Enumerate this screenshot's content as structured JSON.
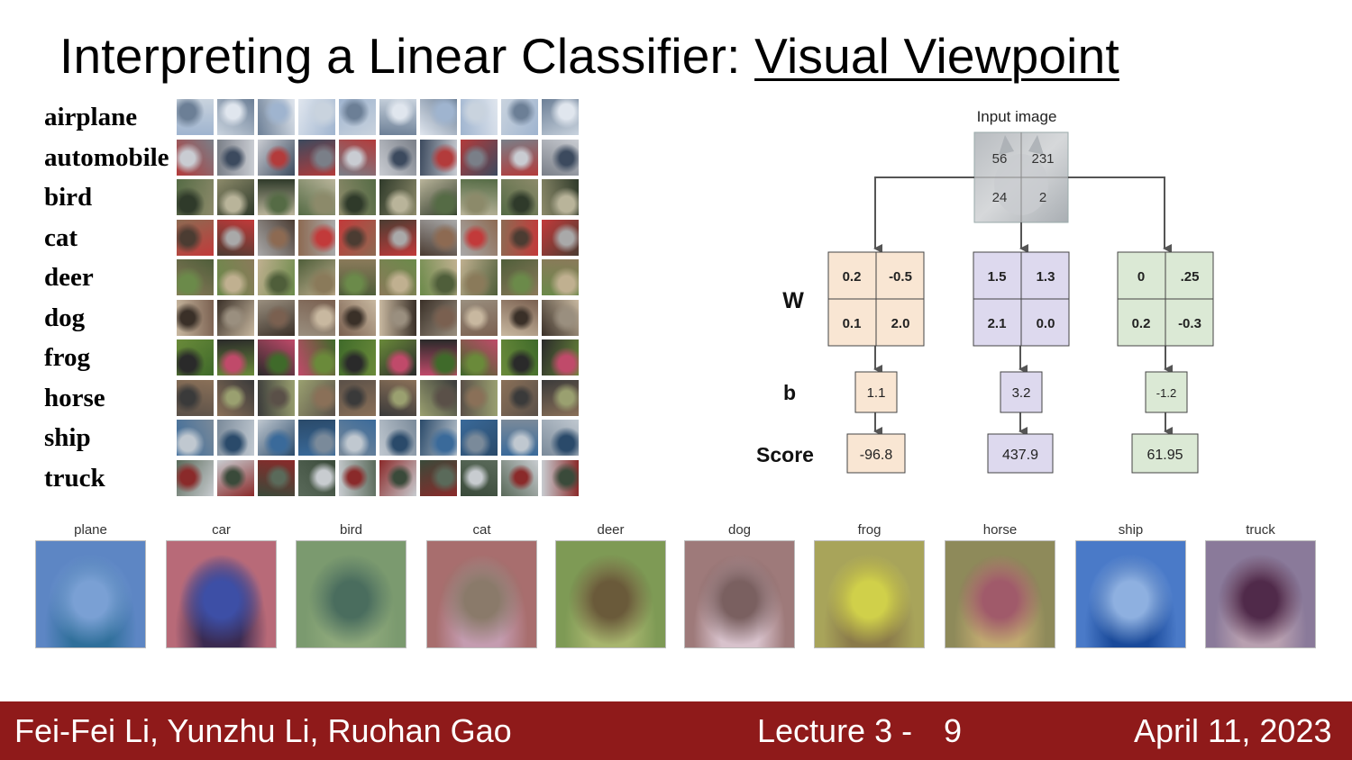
{
  "slide": {
    "title_plain": "Interpreting a Linear Classifier: ",
    "title_underlined": "Visual Viewpoint"
  },
  "classes": [
    "airplane",
    "automobile",
    "bird",
    "cat",
    "deer",
    "dog",
    "frog",
    "horse",
    "ship",
    "truck"
  ],
  "diagram": {
    "input_label": "Input image",
    "pixels": [
      "56",
      "231",
      "24",
      "2"
    ],
    "w_label": "W",
    "b_label": "b",
    "score_label": "Score",
    "columns": [
      {
        "w": [
          "0.2",
          "-0.5",
          "0.1",
          "2.0"
        ],
        "b": "1.1",
        "score": "-96.8",
        "color": "#f9e6d3"
      },
      {
        "w": [
          "1.5",
          "1.3",
          "2.1",
          "0.0"
        ],
        "b": "3.2",
        "score": "437.9",
        "color": "#ddd9ee"
      },
      {
        "w": [
          "0",
          ".25",
          "0.2",
          "-0.3"
        ],
        "b": "-1.2",
        "score": "61.95",
        "color": "#dbe9d5"
      }
    ]
  },
  "templates": [
    {
      "label": "plane",
      "colors": [
        "#5d86c4",
        "#7aa0d4",
        "#2f6f9a"
      ]
    },
    {
      "label": "car",
      "colors": [
        "#b86a78",
        "#3d4fa6",
        "#3a2a50"
      ]
    },
    {
      "label": "bird",
      "colors": [
        "#7b9a6f",
        "#4a6d5e",
        "#8ea97b"
      ]
    },
    {
      "label": "cat",
      "colors": [
        "#a86e6e",
        "#8a7a6a",
        "#c49cb0"
      ]
    },
    {
      "label": "deer",
      "colors": [
        "#7e9a55",
        "#6a5a3a",
        "#a7b56e"
      ]
    },
    {
      "label": "dog",
      "colors": [
        "#9e7a7a",
        "#7a6060",
        "#d8c2cc"
      ]
    },
    {
      "label": "frog",
      "colors": [
        "#a8a45a",
        "#d0d04a",
        "#8a7a4a"
      ]
    },
    {
      "label": "horse",
      "colors": [
        "#8e8a5a",
        "#a05a6a",
        "#c0aa70"
      ]
    },
    {
      "label": "ship",
      "colors": [
        "#4a7ac8",
        "#8eb0e0",
        "#1a4a9a"
      ]
    },
    {
      "label": "truck",
      "colors": [
        "#8a7a9a",
        "#502a4a",
        "#b8a0b0"
      ]
    }
  ],
  "footer": {
    "authors": "Fei-Fei Li, Yunzhu Li, Ruohan Gao",
    "lecture": "Lecture 3 -",
    "page": "9",
    "date": "April 11, 2023"
  }
}
